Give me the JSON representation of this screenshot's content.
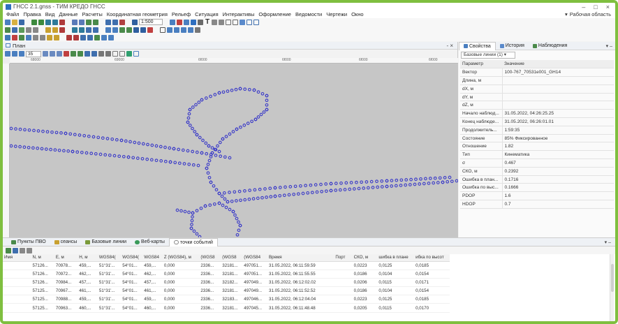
{
  "window": {
    "title": "ГНСС 2.1.gnss - ТИМ КРЕДО ГНСС",
    "controls": [
      "–",
      "□",
      "×"
    ]
  },
  "menu": {
    "items": [
      "Файл",
      "Правка",
      "Вид",
      "Данные",
      "Расчеты",
      "Координатная геометрия",
      "Рельеф",
      "Ситуация",
      "Интерактивы",
      "Оформление",
      "Ведомости",
      "Чертежи",
      "Окно"
    ],
    "workspace": "Рабочая область"
  },
  "toolbar": {
    "scale_value": "1:500",
    "text_tool": "T"
  },
  "plan": {
    "title": "План",
    "controls": "- ×",
    "zoom_percent": "35",
    "ruler_labels": [
      "68000",
      "69000",
      "6f000",
      "6f000",
      "6f000",
      "6f000"
    ]
  },
  "plot": {
    "point_color": "#3a3ac8",
    "background": "#c6c6c6"
  },
  "properties": {
    "tabs": [
      {
        "label": "Свойства",
        "icon": "properties-icon"
      },
      {
        "label": "История",
        "icon": "history-icon"
      },
      {
        "label": "Наблюдения",
        "icon": "observations-icon"
      }
    ],
    "selector": "Базовые линии (1)",
    "header": {
      "param": "Параметр",
      "value": "Значение"
    },
    "rows": [
      {
        "k": "Вектор",
        "v": "100-767_70531e001_GH14"
      },
      {
        "k": "Длина, м",
        "v": ""
      },
      {
        "k": "dX, м",
        "v": ""
      },
      {
        "k": "dY, м",
        "v": ""
      },
      {
        "k": "dZ, м",
        "v": ""
      },
      {
        "k": "Начало наблюд...",
        "v": "31.05.2022, 04:26:25.25"
      },
      {
        "k": "Конец наблюде...",
        "v": "31.05.2022, 06:26:01.01"
      },
      {
        "k": "Продолжитель...",
        "v": "1:59:35"
      },
      {
        "k": "Состояние",
        "v": "85% Фиксированное"
      },
      {
        "k": "Отношение",
        "v": "1.82"
      },
      {
        "k": "Тип",
        "v": "Кинематика"
      },
      {
        "k": "σ",
        "v": "0.467"
      },
      {
        "k": "СКО, м",
        "v": "0.2392"
      },
      {
        "k": "Ошибка в план...",
        "v": "0.1716"
      },
      {
        "k": "Ошибка по выс...",
        "v": "0.1666"
      },
      {
        "k": "PDOP",
        "v": "1.6"
      },
      {
        "k": "HDOP",
        "v": "0.7"
      }
    ]
  },
  "bottom_tabs": [
    {
      "label": "Пункты ПВО",
      "icon": "points-icon"
    },
    {
      "label": "сеансы",
      "icon": "sessions-icon"
    },
    {
      "label": "Базовые линии",
      "icon": "baselines-icon"
    },
    {
      "label": "Веб-карты",
      "icon": "webmaps-icon"
    },
    {
      "label": "точки событий",
      "icon": "event-points-icon",
      "active": true
    }
  ],
  "events_table": {
    "columns": [
      "Имя",
      "N, м",
      "E, м",
      "H, м",
      "WGS84(",
      "WGS84(",
      "WGS84",
      "Z (WGS84), м",
      "(WGS8",
      "(WGS8",
      "(WGS84",
      "Время",
      "Порт",
      "СКО, м",
      "шибка в плане",
      "ибка по высот"
    ],
    "rows": [
      [
        "",
        "57126...",
        "70978...",
        "459,...",
        "51°31'...",
        "54°01...",
        "459,...",
        "0,000",
        "2336...",
        "32181...",
        "497051...",
        "31.05.2022, 06:11:59.59",
        "",
        "0,0223",
        "0,0125",
        "0,0185"
      ],
      [
        "",
        "57126...",
        "70972...",
        "462,...",
        "51°31'...",
        "54°01...",
        "462,...",
        "0,000",
        "2336...",
        "32181...",
        "497051...",
        "31.05.2022, 06:11:55.55",
        "",
        "0,0186",
        "0,0104",
        "0,0154"
      ],
      [
        "",
        "57126...",
        "70984...",
        "457,...",
        "51°31'...",
        "54°01...",
        "457,...",
        "0,000",
        "2336...",
        "32182...",
        "497049...",
        "31.05.2022, 06:12:02.02",
        "",
        "0,0206",
        "0,0115",
        "0,0171"
      ],
      [
        "",
        "57125...",
        "70967...",
        "461,...",
        "51°31'...",
        "54°01...",
        "461,...",
        "0,000",
        "2336...",
        "32181...",
        "497049...",
        "31.05.2022, 06:11:52.52",
        "",
        "0,0186",
        "0,0104",
        "0,0154"
      ],
      [
        "",
        "57125...",
        "70988...",
        "459,...",
        "51°31'...",
        "54°01...",
        "459,...",
        "0,000",
        "2336...",
        "32183...",
        "497046...",
        "31.05.2022, 06:12:04.04",
        "",
        "0,0223",
        "0,0125",
        "0,0185"
      ],
      [
        "",
        "57125...",
        "70963...",
        "460,...",
        "51°31'...",
        "54°01...",
        "460,...",
        "0,000",
        "2336...",
        "32181...",
        "497045...",
        "31.05.2022, 06:11:48.48",
        "",
        "0,0205",
        "0,0115",
        "0,0170"
      ]
    ]
  }
}
